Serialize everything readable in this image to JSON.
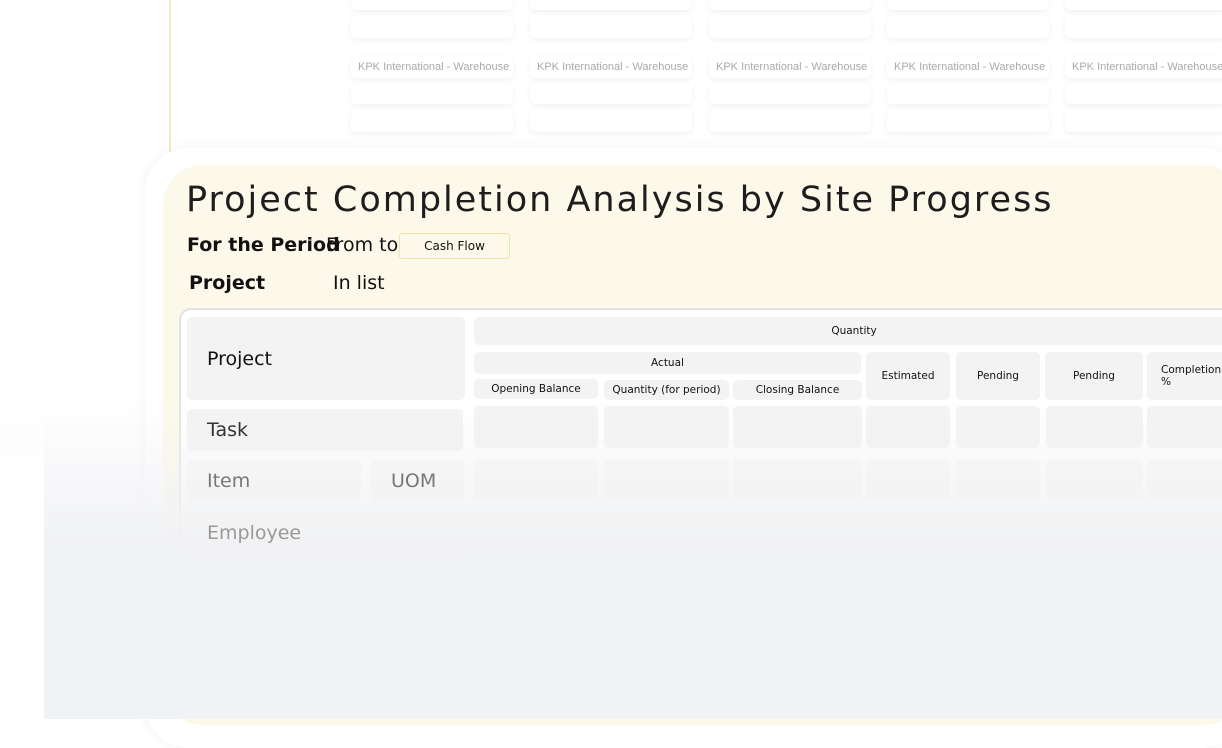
{
  "background_cards": {
    "label": "KPK International - Warehouse",
    "columns": 5
  },
  "report": {
    "title": "Project Completion Analysis by Site Progress",
    "period_label": "For the Period",
    "from_to": "From to",
    "cash_flow_value": "Cash Flow",
    "project_label": "Project",
    "project_filter": "In list"
  },
  "table": {
    "row_headers": {
      "project": "Project",
      "task": "Task",
      "item": "Item",
      "uom": "UOM",
      "employee": "Employee"
    },
    "quantity": "Quantity",
    "actual": "Actual",
    "opening_balance": "Opening Balance",
    "quantity_period": "Quantity (for period)",
    "closing_balance": "Closing Balance",
    "estimated": "Estimated",
    "pending1": "Pending",
    "pending2": "Pending",
    "completion": "Completion %"
  },
  "colors": {
    "panel": "#fdf9ea",
    "cell": "#f3f3f3",
    "page_bottom": "#f1f2f5"
  }
}
